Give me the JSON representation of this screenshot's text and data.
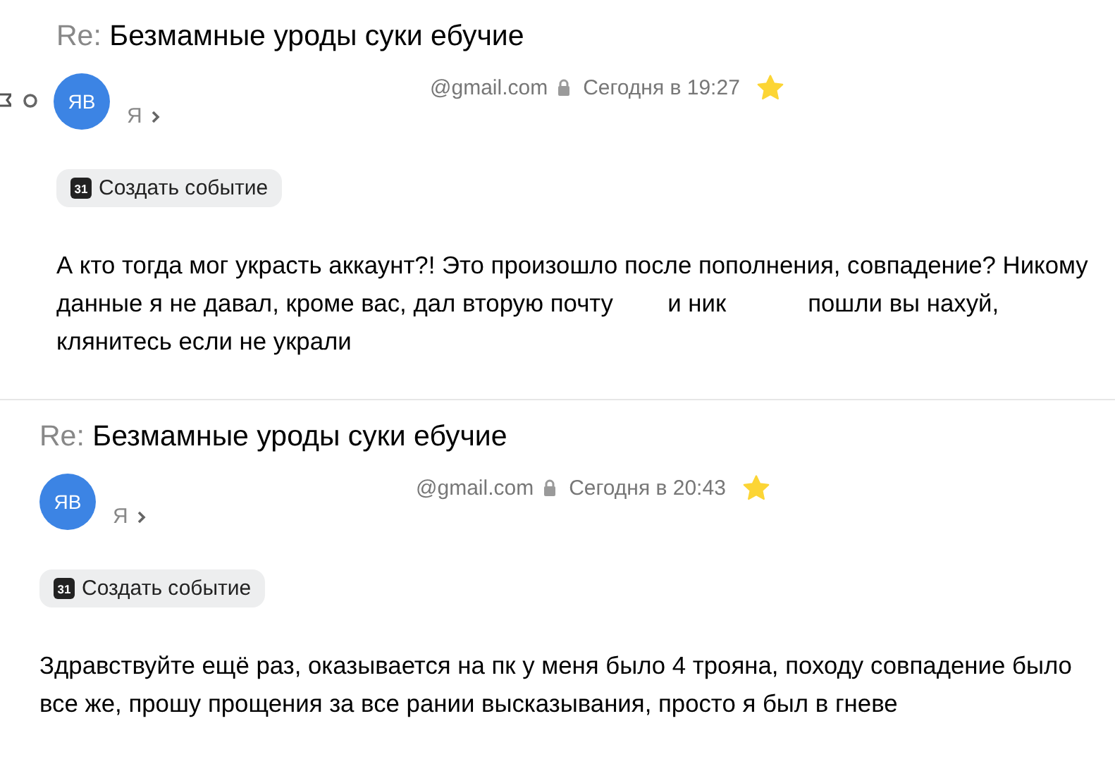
{
  "messages": [
    {
      "subject_prefix": "Re:",
      "subject": "Безмамные уроды суки ебучие",
      "side_icons": true,
      "avatar": "ЯВ",
      "sender": "@gmail.com",
      "secured": true,
      "time": "Сегодня в 19:27",
      "starred": true,
      "recipient": "Я",
      "event_button": {
        "icon_label": "31",
        "label": "Создать событие"
      },
      "body": [
        "А кто тогда мог украсть аккаунт?! Это произошло после пополнения, совпадение? Никому",
        "данные я не давал, кроме вас, дал вторую почту        и ник            пошли вы нахуй,",
        "клянитесь если не украли"
      ]
    },
    {
      "subject_prefix": "Re:",
      "subject": "Безмамные уроды суки ебучие",
      "side_icons": false,
      "avatar": "ЯВ",
      "sender": "@gmail.com",
      "secured": true,
      "time": "Сегодня в 20:43",
      "starred": true,
      "recipient": "Я",
      "event_button": {
        "icon_label": "31",
        "label": "Создать событие"
      },
      "body": [
        "Здравствуйте ещё раз, оказывается на пк у меня было 4 трояна, походу совпадение было",
        "все же, прошу прощения за все рании высказывания, просто я был в гневе"
      ]
    }
  ]
}
